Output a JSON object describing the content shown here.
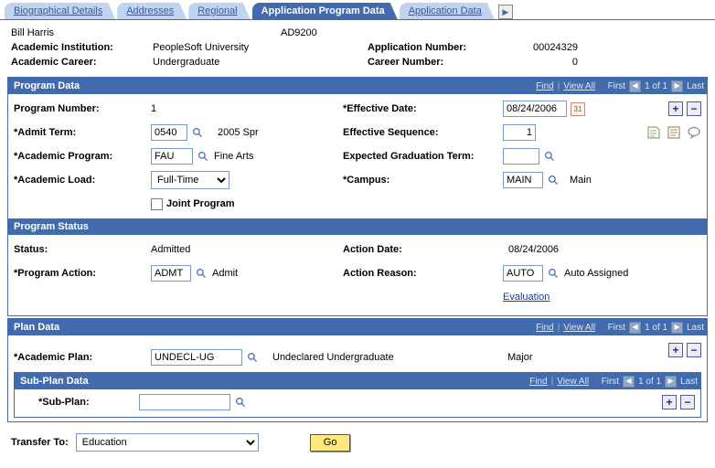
{
  "tabs": {
    "items": [
      {
        "label": "Biographical Details",
        "active": false
      },
      {
        "label": "Addresses",
        "active": false
      },
      {
        "label": "Regional",
        "active": false
      },
      {
        "label": "Application Program Data",
        "active": true
      },
      {
        "label": "Application Data",
        "active": false
      }
    ]
  },
  "header": {
    "name": "Bill Harris",
    "app_code": "AD9200",
    "acad_inst_lbl": "Academic Institution:",
    "acad_inst_val": "PeopleSoft University",
    "app_num_lbl": "Application Number:",
    "app_num_val": "00024329",
    "acad_career_lbl": "Academic Career:",
    "acad_career_val": "Undergraduate",
    "career_num_lbl": "Career Number:",
    "career_num_val": "0"
  },
  "nav": {
    "find": "Find",
    "view_all": "View All",
    "first": "First",
    "last": "Last",
    "of": "1 of 1"
  },
  "program_data": {
    "title": "Program Data",
    "prog_num_lbl": "Program Number:",
    "prog_num_val": "1",
    "eff_date_lbl": "*Effective Date:",
    "eff_date_val": "08/24/2006",
    "admit_term_lbl": "*Admit Term:",
    "admit_term_val": "0540",
    "admit_term_desc": "2005 Spr",
    "eff_seq_lbl": "Effective Sequence:",
    "eff_seq_val": "1",
    "acad_prog_lbl": "*Academic Program:",
    "acad_prog_val": "FAU",
    "acad_prog_desc": "Fine Arts",
    "exp_grad_lbl": "Expected Graduation Term:",
    "exp_grad_val": "",
    "acad_load_lbl": "*Academic Load:",
    "acad_load_val": "Full-Time",
    "campus_lbl": "*Campus:",
    "campus_val": "MAIN",
    "campus_desc": "Main",
    "joint_lbl": "Joint Program"
  },
  "program_status": {
    "title": "Program Status",
    "status_lbl": "Status:",
    "status_val": "Admitted",
    "action_date_lbl": "Action Date:",
    "action_date_val": "08/24/2006",
    "prog_action_lbl": "*Program Action:",
    "prog_action_val": "ADMT",
    "prog_action_desc": "Admit",
    "action_reason_lbl": "Action Reason:",
    "action_reason_val": "AUTO",
    "action_reason_desc": "Auto Assigned",
    "evaluation_link": "Evaluation"
  },
  "plan_data": {
    "title": "Plan Data",
    "acad_plan_lbl": "*Academic Plan:",
    "acad_plan_val": "UNDECL-UG",
    "acad_plan_desc": "Undeclared Undergraduate",
    "acad_plan_type": "Major",
    "sub_title": "Sub-Plan Data",
    "sub_plan_lbl": "*Sub-Plan:",
    "sub_plan_val": ""
  },
  "footer": {
    "transfer_lbl": "Transfer To:",
    "transfer_val": "Education",
    "go_lbl": "Go"
  }
}
